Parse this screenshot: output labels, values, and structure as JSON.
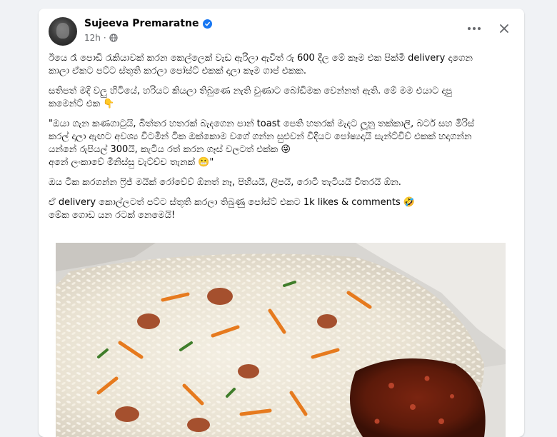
{
  "post": {
    "author": "Sujeeva Premaratne",
    "time": "12h",
    "paragraphs": [
      {
        "lines": [
          "ඊයෙ රෑ පොඩි රැකියාවක් කරන කෙල්ලෙක් වැඩ ඇරිලා ඇවිත් රු 600 දීල මේ කෑම එක පික්මී delivery දාගෙන",
          "කාලා ඒකට පට්ට ස්තූති කරලා පෝස්ට් එකක් දාලා කෑම ගාප් එකක."
        ]
      },
      {
        "lines": [
          "සතිපත් මදි වලු හිටියේ, හරියට කියලා තිබුණෙ නැති වුණාට බෝඩිමක වෙන්නත් ඇති. මේ මම එයාට දාපු",
          "කමෙන්ට් එක 👇"
        ]
      },
      {
        "lines": [
          "\"ඔයා ගැන කණගාටුයි, බිත්තර හතරක් බැදගෙන පාන් toast පෙති හතරක් මැදට ලූනු තක්කාලි, බටර් සහ මිරිස්",
          "කරල් දාලා ඇඟට අවශ්‍ය විටමින් ටික ඔක්කොම වගේ ගන්න සුළුවන් විදියට පෝෂ්‍යදායි සැන්ට්විච් එකක් හදාගන්න",
          "යන්නේ රුපියල් 300යි, කැටිය රත් කරන ගෑස් වලටත් එක්ක 😜",
          "අනේ ලංකාවේ මිනිස්සු වැට්ච්ච තැනක් 😬\""
        ]
      },
      {
        "lines": [
          "ඔය ටික කරගන්න ෆ්‍රිජ් මයික් රෝවේව් ඕනත් නෑ, පිහියයි, ලිපයි, රොටි තැටියයි විතරයි ඕන."
        ]
      },
      {
        "lines": [
          "ඒ delivery කොල්ලටත් පට්ට ස්තූති කරලා තිබුණු පෝස්ට් එකට 1k likes & comments 🤣",
          "මේක ගොඩ යන රටක් නෙමෙයි!"
        ]
      }
    ]
  },
  "icons": {
    "verified": "verified-badge-icon",
    "privacy": "globe-icon",
    "more": "more-options-icon",
    "close": "close-icon"
  },
  "colors": {
    "card_bg": "#ffffff",
    "page_bg": "#f0f2f5",
    "verified_blue": "#1877f2",
    "secondary_text": "#65676b"
  }
}
